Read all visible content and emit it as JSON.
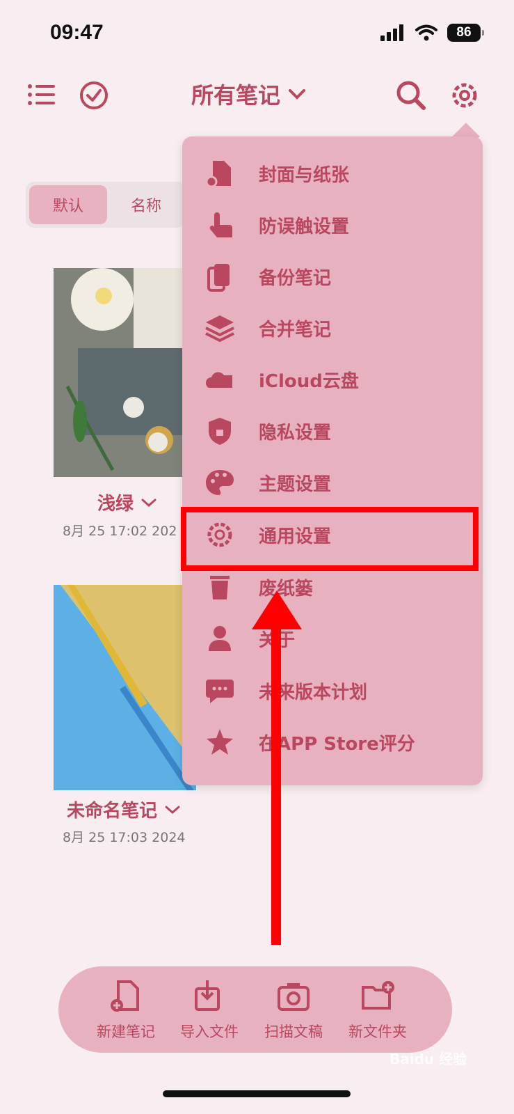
{
  "status_bar": {
    "time": "09:47",
    "battery": "86"
  },
  "header": {
    "title": "所有笔记"
  },
  "sort": {
    "default_label": "默认",
    "name_label": "名称"
  },
  "notes": [
    {
      "title": "浅绿",
      "date": "8月 25 17:02 202"
    },
    {
      "title": "未命名笔记",
      "date": "8月 25 17:03 2024"
    }
  ],
  "menu": {
    "items": [
      {
        "label": "封面与纸张",
        "icon": "file-gear-icon"
      },
      {
        "label": "防误触设置",
        "icon": "touch-hand-icon"
      },
      {
        "label": "备份笔记",
        "icon": "backup-icon"
      },
      {
        "label": "合并笔记",
        "icon": "layers-icon"
      },
      {
        "label": "iCloud云盘",
        "icon": "cloud-drive-icon"
      },
      {
        "label": "隐私设置",
        "icon": "shield-lock-icon"
      },
      {
        "label": "主题设置",
        "icon": "palette-icon"
      },
      {
        "label": "通用设置",
        "icon": "gear-icon"
      },
      {
        "label": "废纸篓",
        "icon": "trash-icon"
      },
      {
        "label": "关于",
        "icon": "person-icon"
      },
      {
        "label": "未来版本计划",
        "icon": "chat-bubble-icon"
      },
      {
        "label": "在APP Store评分",
        "icon": "star-icon"
      }
    ]
  },
  "bottom_bar": {
    "new_note": "新建笔记",
    "import_file": "导入文件",
    "scan_doc": "扫描文稿",
    "new_folder": "新文件夹"
  },
  "watermark": "Baidu 经验",
  "colors": {
    "accent": "#b9475f",
    "menu_bg": "#e8b1c0",
    "page_bg": "#f8eef1",
    "annotation_red": "#ff0000"
  }
}
